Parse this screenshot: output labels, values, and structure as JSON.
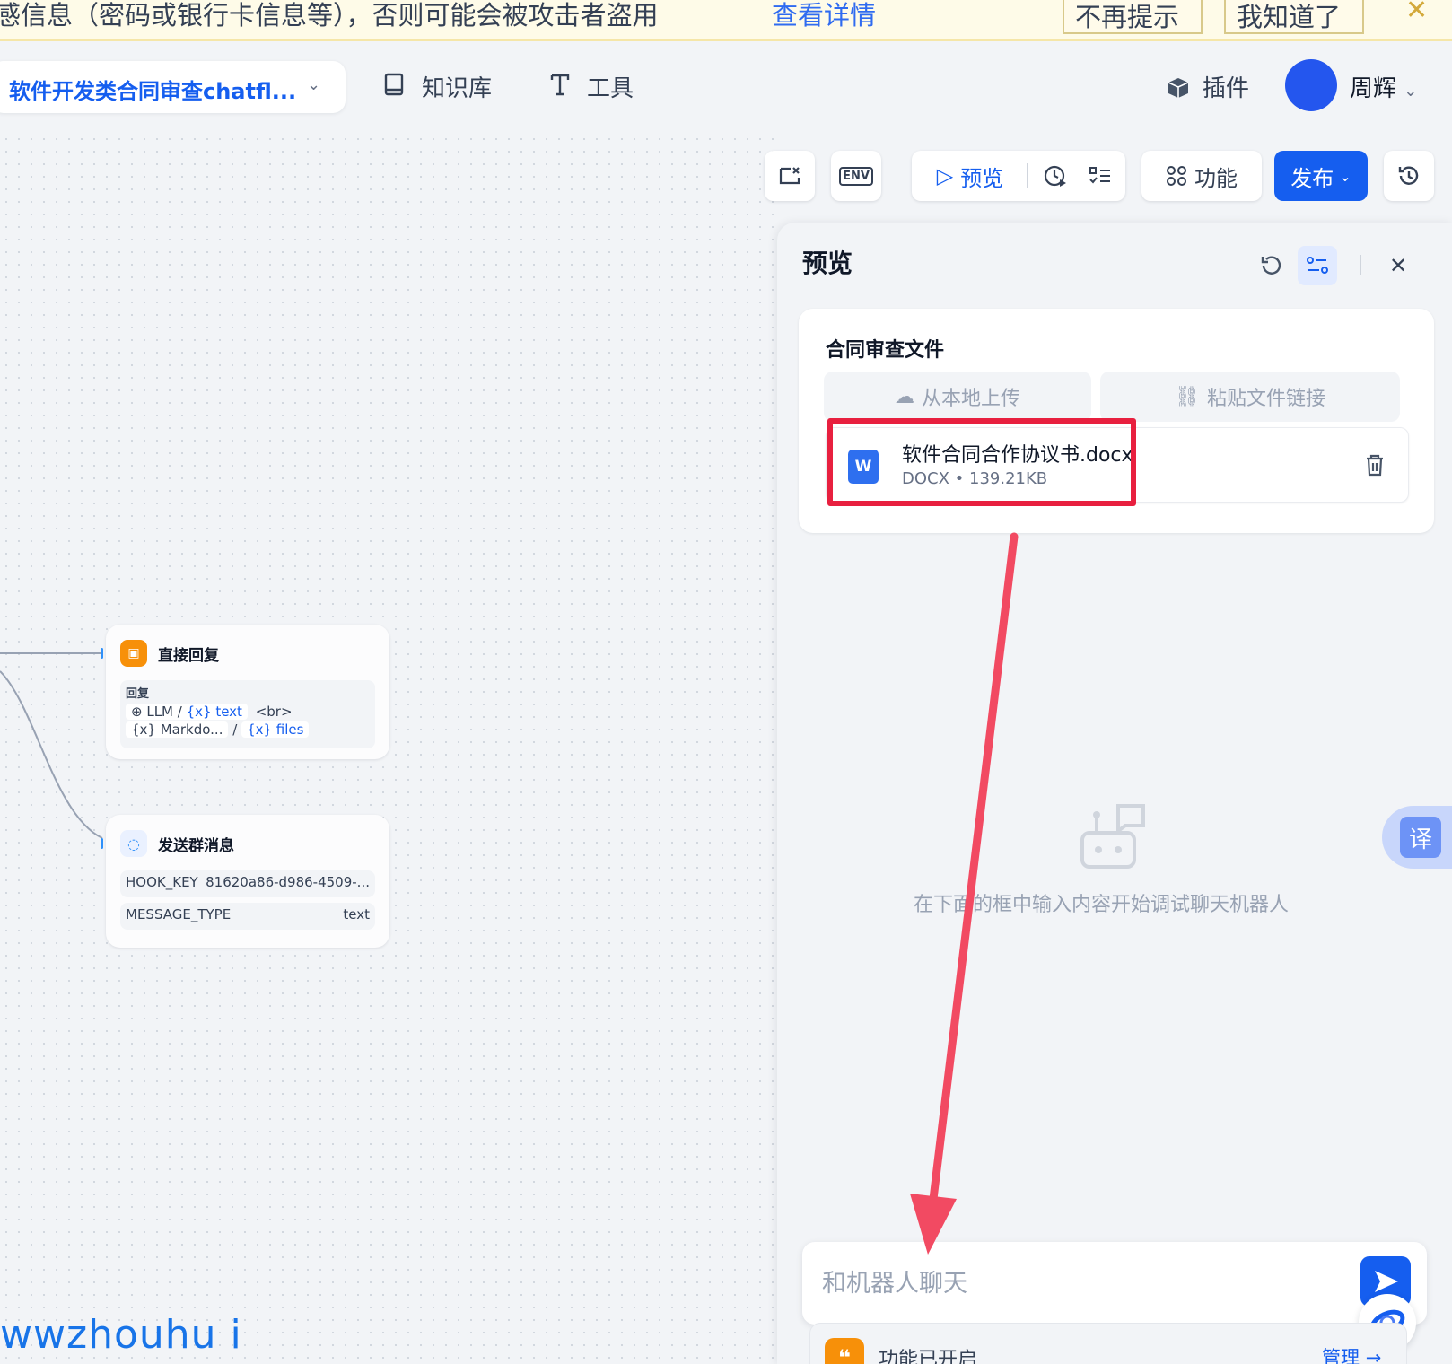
{
  "banner": {
    "text": "感信息（密码或银行卡信息等），否则可能会被攻击者盗用",
    "link": "查看详情",
    "dismiss_label": "不再提示",
    "ack_label": "我知道了",
    "close_icon": "close-icon"
  },
  "header": {
    "app_title": "软件开发类合同审查chatfl...",
    "nav": {
      "knowledge": "知识库",
      "tools": "工具"
    },
    "plugin": "插件",
    "user_name": "周辉"
  },
  "toolbar": {
    "preview_label": "预览",
    "features_label": "功能",
    "publish_label": "发布",
    "env_label": "ENV"
  },
  "nodes": {
    "reply": {
      "title": "直接回复",
      "section": "回复",
      "line1": {
        "source": "LLM",
        "var": "{x} text",
        "suffix": "<br>"
      },
      "line2": {
        "source": "{x} Markdo...",
        "var": "{x} files"
      }
    },
    "group_msg": {
      "title": "发送群消息",
      "rows": [
        {
          "key": "HOOK_KEY",
          "value": "81620a86-d986-4509-..."
        },
        {
          "key": "MESSAGE_TYPE",
          "value": "text"
        }
      ]
    }
  },
  "preview": {
    "title": "预览",
    "card_title": "合同审查文件",
    "upload_local": "从本地上传",
    "paste_link": "粘贴文件链接",
    "file": {
      "name": "软件合同合作协议书.docx",
      "type": "DOCX",
      "size": "139.21KB",
      "icon_letter": "W"
    },
    "empty_hint": "在下面的框中输入内容开始调试聊天机器人",
    "chat_placeholder": "和机器人聊天",
    "feature_status": "功能已开启",
    "manage_label": "管理"
  },
  "translate_label": "译",
  "watermark": "wwzhouhu i",
  "colors": {
    "accent": "#155eef",
    "annotation": "#e8203f",
    "banner_bg": "#fefbe8"
  }
}
